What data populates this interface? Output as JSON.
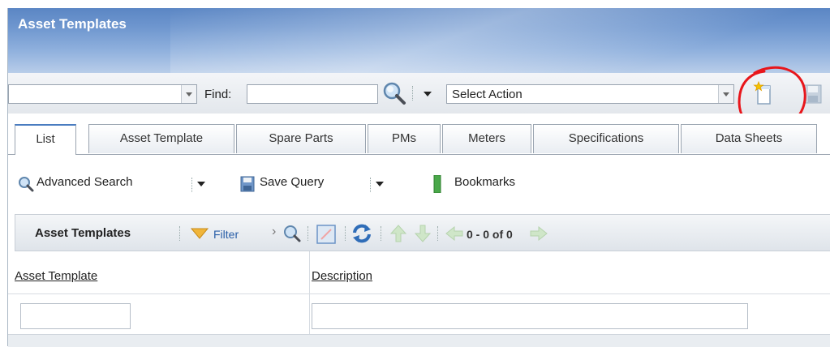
{
  "banner": {
    "title": "Asset Templates"
  },
  "toolbar": {
    "view_value": "",
    "find_label": "Find:",
    "find_value": "",
    "action_value": "Select Action"
  },
  "tabs": [
    {
      "label": "List"
    },
    {
      "label": "Asset Template"
    },
    {
      "label": "Spare Parts"
    },
    {
      "label": "PMs"
    },
    {
      "label": "Meters"
    },
    {
      "label": "Specifications"
    },
    {
      "label": "Data Sheets"
    }
  ],
  "subbar": {
    "advanced_search": "Advanced Search",
    "save_query": "Save Query",
    "bookmarks": "Bookmarks"
  },
  "grid": {
    "title": "Asset Templates",
    "filter_label": "Filter",
    "paging": "0 - 0 of 0",
    "columns": [
      "Asset Template",
      "Description"
    ],
    "filter_row": [
      "",
      ""
    ]
  },
  "colors": {
    "accent": "#4a7cc0",
    "annotation": "#e8161b"
  }
}
